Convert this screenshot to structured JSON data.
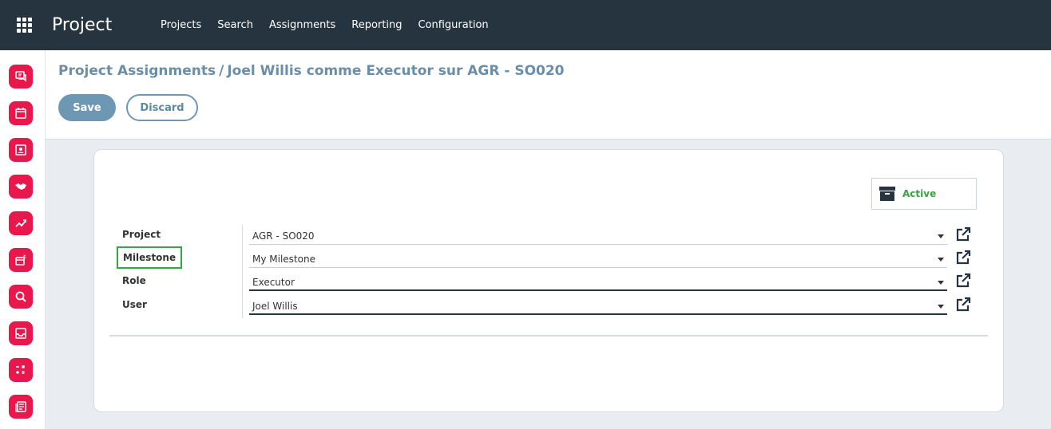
{
  "app": {
    "title": "Project"
  },
  "topnav": [
    "Projects",
    "Search",
    "Assignments",
    "Reporting",
    "Configuration"
  ],
  "breadcrumb": {
    "parent": "Project Assignments",
    "separator": "/",
    "current": "Joel Willis comme Executor sur AGR - SO020"
  },
  "buttons": {
    "save": "Save",
    "discard": "Discard"
  },
  "status": {
    "label": "Active",
    "color": "#3aa340"
  },
  "form": {
    "fields": [
      {
        "label": "Project",
        "value": "AGR - SO020"
      },
      {
        "label": "Milestone",
        "value": "My Milestone"
      },
      {
        "label": "Role",
        "value": "Executor"
      },
      {
        "label": "User",
        "value": "Joel Willis"
      }
    ]
  },
  "sidebar_icons": [
    "chat-icon",
    "calendar-icon",
    "contacts-icon",
    "handshake-icon",
    "trending-icon",
    "invoice-icon",
    "search-icon",
    "inbox-icon",
    "calculator-icon",
    "document-icon"
  ],
  "colors": {
    "topbar": "#26343f",
    "accent": "#e8184c",
    "primary": "#6e97b4",
    "highlight": "#2fa847"
  }
}
